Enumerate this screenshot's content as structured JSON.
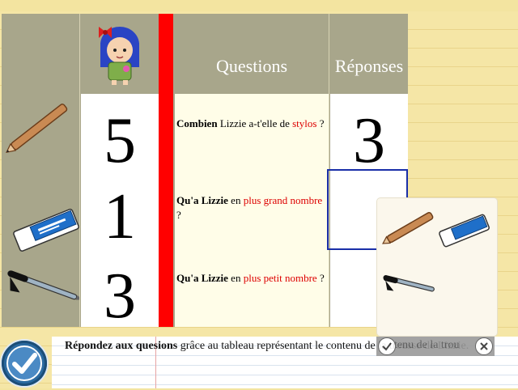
{
  "table": {
    "questions_header": "Questions",
    "responses_header": "Réponses",
    "numbers": [
      "5",
      "1",
      "3"
    ],
    "rows": [
      {
        "bold": "Combien",
        "normal1": " Lizzie a-t'elle de",
        "red": "stylos",
        "normal2": " ?"
      },
      {
        "bold": "Qu'a Lizzie",
        "normal1": " en ",
        "red": "plus grand nombre",
        "normal2": " ?"
      },
      {
        "bold": "Qu'a Lizzie",
        "normal1": " en ",
        "red": "plus petit nombre",
        "normal2": " ?"
      }
    ],
    "answers": [
      "3",
      "",
      ""
    ]
  },
  "instruction": {
    "bold": "Répondez aux quesions",
    "rest": " grâce au tableau représentant le contenu de la trousse de Lizzie."
  },
  "toolbar": {
    "label": "tenu de la trou"
  },
  "colors": {
    "header_bg": "#a8a68b",
    "red_bar": "#ff0000",
    "answer_box": "#1a2fa8",
    "accent_text": "#dd0000"
  },
  "icons": [
    "girl-avatar-icon",
    "pencil-icon",
    "eraser-icon",
    "pen-icon",
    "check-icon",
    "close-icon"
  ]
}
